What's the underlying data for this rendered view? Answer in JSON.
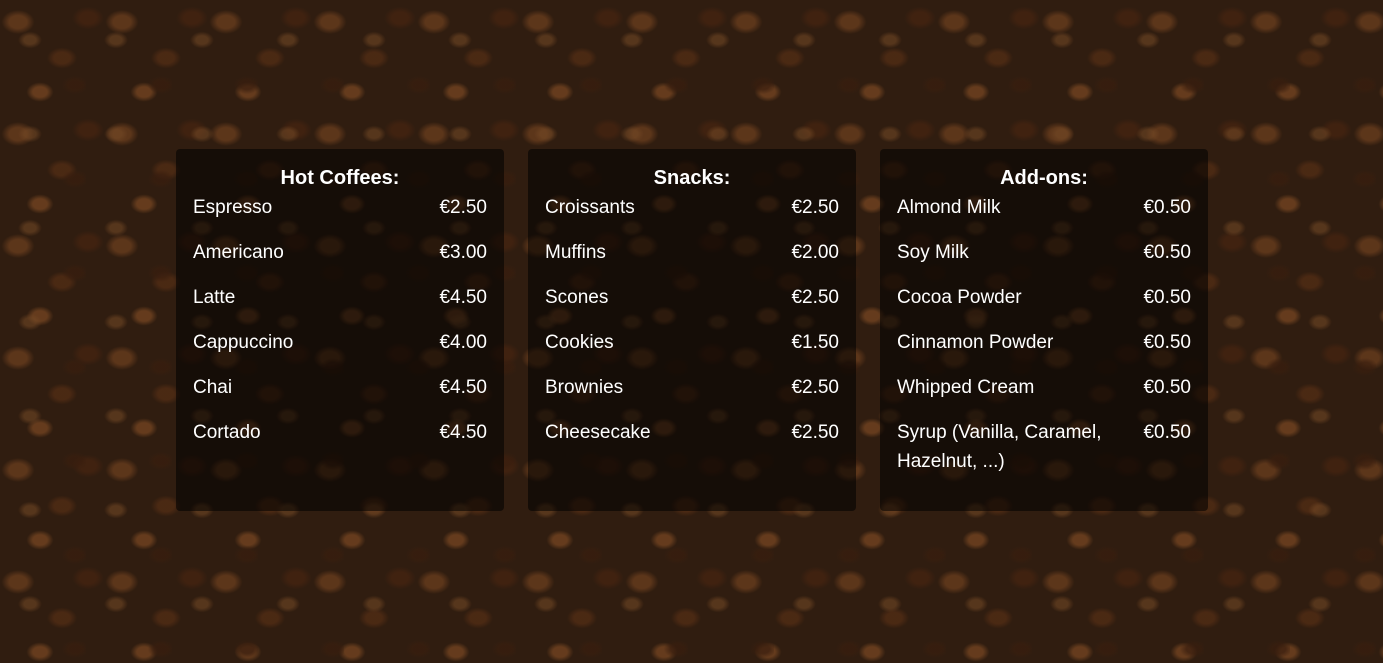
{
  "menu": {
    "sections": [
      {
        "title": "Hot Coffees:",
        "items": [
          {
            "name": "Espresso",
            "price": "€2.50"
          },
          {
            "name": "Americano",
            "price": "€3.00"
          },
          {
            "name": "Latte",
            "price": "€4.50"
          },
          {
            "name": "Cappuccino",
            "price": "€4.00"
          },
          {
            "name": "Chai",
            "price": "€4.50"
          },
          {
            "name": "Cortado",
            "price": "€4.50"
          }
        ]
      },
      {
        "title": "Snacks:",
        "items": [
          {
            "name": "Croissants",
            "price": "€2.50"
          },
          {
            "name": "Muffins",
            "price": "€2.00"
          },
          {
            "name": "Scones",
            "price": "€2.50"
          },
          {
            "name": "Cookies",
            "price": "€1.50"
          },
          {
            "name": "Brownies",
            "price": "€2.50"
          },
          {
            "name": "Cheesecake",
            "price": "€2.50"
          }
        ]
      },
      {
        "title": "Add-ons:",
        "items": [
          {
            "name": "Almond Milk",
            "price": "€0.50"
          },
          {
            "name": "Soy Milk",
            "price": "€0.50"
          },
          {
            "name": "Cocoa Powder",
            "price": "€0.50"
          },
          {
            "name": "Cinnamon Powder",
            "price": "€0.50"
          },
          {
            "name": "Whipped Cream",
            "price": "€0.50"
          },
          {
            "name": "Syrup (Vanilla, Caramel, Hazelnut, ...)",
            "price": "€0.50"
          }
        ]
      }
    ]
  }
}
